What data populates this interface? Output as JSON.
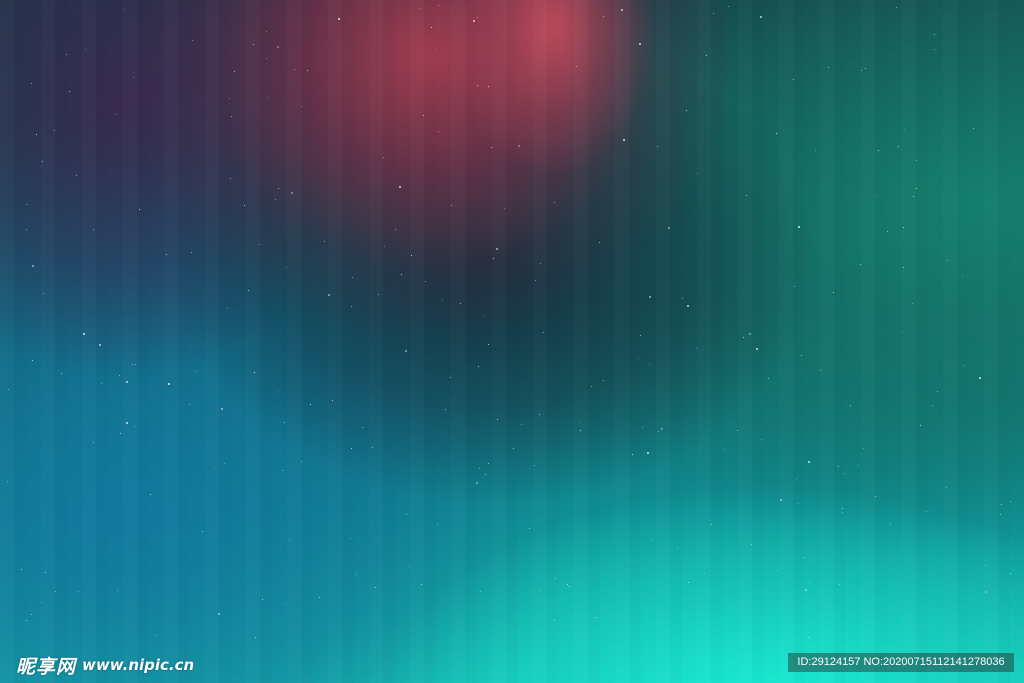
{
  "image": {
    "description_colors": {
      "red": "#aa3c50",
      "purple": "#3c2850",
      "teal": "#1278a0",
      "green": "#14826e",
      "cyan": "#19f0d7",
      "dark": "#162d3c"
    }
  },
  "watermark": {
    "brand": "昵享网",
    "url": "www.nipic.cn",
    "id_text": "ID:29124157 NO:20200715112141278036"
  }
}
